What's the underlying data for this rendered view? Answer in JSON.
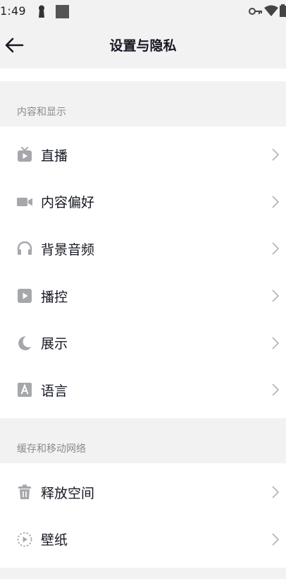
{
  "status_bar": {
    "time": "1:49",
    "icons": [
      "keyhole-icon",
      "square-icon",
      "vpn-key-icon",
      "wifi-icon",
      "battery-icon"
    ]
  },
  "header": {
    "title": "设置与隐私",
    "back_icon": "arrow-left-icon"
  },
  "sections": [
    {
      "title": "内容和显示",
      "items": [
        {
          "label": "直播",
          "icon": "tv-icon"
        },
        {
          "label": "内容偏好",
          "icon": "video-camera-icon"
        },
        {
          "label": "背景音频",
          "icon": "headphones-icon"
        },
        {
          "label": "播控",
          "icon": "play-square-icon"
        },
        {
          "label": "展示",
          "icon": "moon-icon"
        },
        {
          "label": "语言",
          "icon": "letter-a-icon"
        }
      ]
    },
    {
      "title": "缓存和移动网络",
      "items": [
        {
          "label": "释放空间",
          "icon": "trash-icon"
        },
        {
          "label": "壁纸",
          "icon": "wallpaper-play-icon"
        }
      ]
    }
  ],
  "colors": {
    "background": "#f2f2f2",
    "surface": "#ffffff",
    "text_primary": "#161823",
    "text_secondary": "#8a8b91",
    "icon_gray": "#a6a7ab",
    "chevron": "#b5b6ba"
  }
}
